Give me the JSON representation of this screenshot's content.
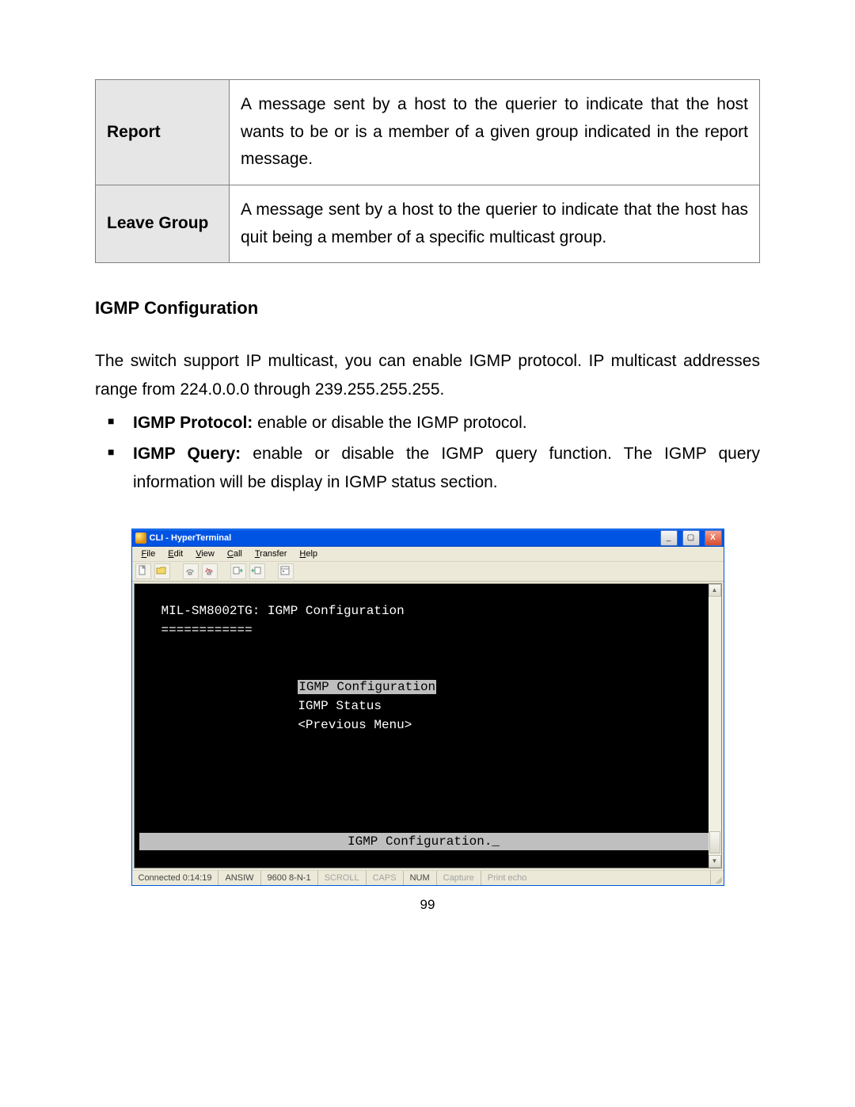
{
  "table": {
    "rows": [
      {
        "term": "Report",
        "desc": "A message sent by a host to the querier to indicate that the host wants to be or is a member of a given group indicated in the report message."
      },
      {
        "term": "Leave Group",
        "desc": "A message sent by a host to the querier to indicate that the host has quit being a member of a specific multicast group."
      }
    ]
  },
  "section_title": "IGMP Configuration",
  "paragraph": "The switch support IP multicast, you can enable IGMP protocol. IP multicast addresses range from 224.0.0.0 through 239.255.255.255.",
  "bullets": [
    {
      "label": "IGMP Protocol:",
      "text": " enable or disable the IGMP protocol."
    },
    {
      "label": "IGMP Query:",
      "text": " enable or disable the IGMP query function. The IGMP query information will be display in IGMP status section."
    }
  ],
  "hyperterminal": {
    "title": "CLI - HyperTerminal",
    "menu": [
      "File",
      "Edit",
      "View",
      "Call",
      "Transfer",
      "Help"
    ],
    "toolbar_icons": [
      "new-file-icon",
      "open-icon",
      "print-icon",
      "disconnect-icon",
      "send-icon",
      "receive-icon",
      "properties-icon"
    ],
    "terminal": {
      "header": "MIL-SM8002TG: IGMP Configuration",
      "underline": "============",
      "menu_items": [
        "IGMP Configuration",
        "IGMP Status",
        "<Previous Menu>"
      ],
      "selected_index": 0,
      "footer": "IGMP Configuration._"
    },
    "statusbar": {
      "connected": "Connected 0:14:19",
      "emulation": "ANSIW",
      "settings": "9600 8-N-1",
      "scroll": "SCROLL",
      "caps": "CAPS",
      "num": "NUM",
      "capture": "Capture",
      "printecho": "Print echo"
    },
    "winbuttons": {
      "min": "_",
      "max": "▢",
      "close": "X"
    }
  },
  "page_number": "99"
}
